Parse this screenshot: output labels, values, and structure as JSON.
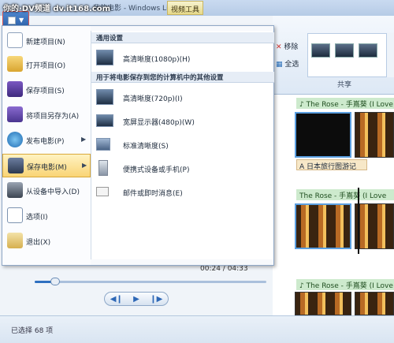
{
  "title_bar": {
    "window_title": "我的电影 - Windows Live 影",
    "context_tab": "视频工具",
    "overlay_caption": "你的·DV频道 dv.it168.com"
  },
  "ribbon": {
    "remove_label": "移除",
    "select_all_label": "全选",
    "share_group_label": "共享"
  },
  "storyboard": {
    "clip_caption_1": "♪ The Rose - 手嶌葵 (I Love",
    "text_caption": "A 日本旅行图游记",
    "clip_caption_2": "The Rose - 手嶌葵 (I Love",
    "clip_caption_3": "♪ The Rose - 手嶌葵 (I Love"
  },
  "player": {
    "time": "00:24 / 04:33",
    "progress": 0.09
  },
  "status_bar": {
    "text": "已选择 68 项"
  },
  "menu": {
    "items": [
      {
        "label": "新建项目(N)",
        "icon": "new-project-icon"
      },
      {
        "label": "打开项目(O)",
        "icon": "open-folder-icon"
      },
      {
        "label": "保存项目(S)",
        "icon": "save-icon"
      },
      {
        "label": "将项目另存为(A)",
        "icon": "save-as-icon"
      },
      {
        "label": "发布电影(P)",
        "icon": "globe-icon",
        "submenu": true
      },
      {
        "label": "保存电影(M)",
        "icon": "film-save-icon",
        "submenu": true,
        "highlighted": true
      },
      {
        "label": "从设备中导入(D)",
        "icon": "camera-icon"
      },
      {
        "label": "选项(I)",
        "icon": "options-icon"
      },
      {
        "label": "退出(X)",
        "icon": "exit-icon"
      }
    ],
    "submenu": {
      "header_common": "通用设置",
      "header_other": "用于将电影保存到您的计算机中的其他设置",
      "items": [
        {
          "label": "高清晰度(1080p)(H)",
          "icon": "monitor-icon"
        },
        {
          "label": "高清晰度(720p)(I)",
          "icon": "monitor-icon"
        },
        {
          "label": "宽屏显示器(480p)(W)",
          "icon": "widescreen-monitor-icon"
        },
        {
          "label": "标准清晰度(S)",
          "icon": "computer-icon"
        },
        {
          "label": "便携式设备或手机(P)",
          "icon": "phone-icon"
        },
        {
          "label": "邮件或即时消息(E)",
          "icon": "email-icon"
        }
      ]
    }
  }
}
